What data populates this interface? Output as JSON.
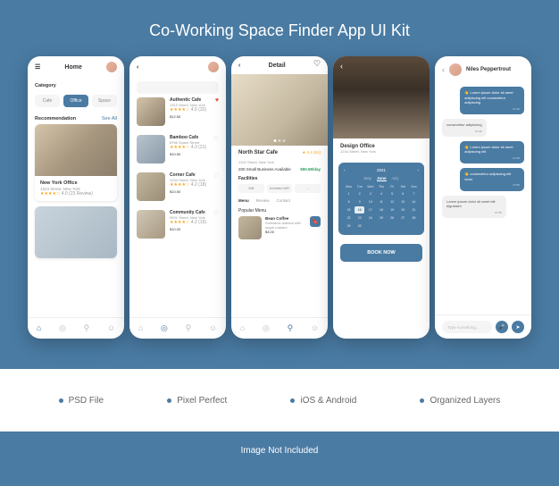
{
  "title": "Co-Working Space Finder App UI Kit",
  "features": [
    "PSD File",
    "Pixel Perfect",
    "iOS & Android",
    "Organized Layers"
  ],
  "caption": "Image Not Included",
  "s1": {
    "header": "Home",
    "category_label": "Category",
    "cats": [
      "Cafe",
      "Office",
      "Space"
    ],
    "rec_label": "Recommendation",
    "see_all": "See All",
    "card1": {
      "name": "New York Office",
      "addr": "1323 Street, New York",
      "rating": "4.0 (23 Review)"
    },
    "card2": {
      "name": ""
    }
  },
  "s2": {
    "items": [
      {
        "name": "Authentic Cafe",
        "addr": "1313 Street, New York",
        "rating": "4.5 (32)",
        "price": "$12.50",
        "fav": true
      },
      {
        "name": "Bamboo Cafe",
        "addr": "8766 Space Street",
        "rating": "4.3 (21)",
        "price": "$10.50",
        "fav": false
      },
      {
        "name": "Corner Cafe",
        "addr": "1234 Street, New York",
        "rating": "4.2 (18)",
        "price": "$10.50",
        "fav": false
      },
      {
        "name": "Community Cafe",
        "addr": "9901 Street, New York",
        "rating": "4.2 (15)",
        "price": "$10.00",
        "fav": false
      }
    ]
  },
  "s3": {
    "header": "Detail",
    "name": "North Star Cafe",
    "rating": "4.4 (61)",
    "addr": "1320 Street, New York",
    "avail": "200 Small Business Available",
    "price": "$90.99/day",
    "fac_label": "Facilities",
    "facs": [
      "Wifi",
      "Unlimited WiFi",
      "..."
    ],
    "tabs": [
      "Menu",
      "Review",
      "Contact"
    ],
    "pop_label": "Popular Menu",
    "pop": {
      "name": "Bean Coffee",
      "desc": "Sumatera arabica with sugar roasted",
      "price": "$3.00"
    }
  },
  "s4": {
    "name": "Design Office",
    "addr": "1234 Street, New York",
    "year": "2021",
    "months": [
      "May",
      "June",
      "July"
    ],
    "wk": [
      "Mon",
      "Tue",
      "Wed",
      "Thu",
      "Fri",
      "Sat",
      "Sun"
    ],
    "book": "BOOK NOW"
  },
  "s5": {
    "name": "Niles Peppertrout",
    "msgs": [
      {
        "who": "me",
        "text": "Lorem ipsum dolor sit amet adipiscing elit consectetur adipiscing",
        "ts": "07:12"
      },
      {
        "who": "them",
        "text": "consectetur adipiscing",
        "ts": "07:30"
      },
      {
        "who": "me",
        "text": "Lorem ipsum dolor sit amet adipiscing elit",
        "ts": "07:40"
      },
      {
        "who": "me",
        "text": "consectetur adipiscing elit dolor",
        "ts": "07:52"
      },
      {
        "who": "them",
        "text": "Lorem ipsum dolor sit amet elit dignissim",
        "ts": "07:55"
      }
    ],
    "placeholder": "Type something..."
  }
}
